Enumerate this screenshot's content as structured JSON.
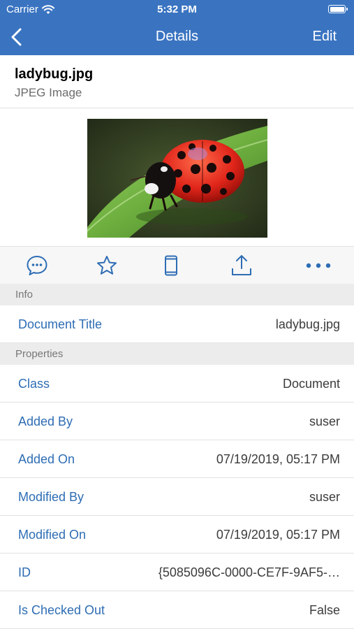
{
  "status_bar": {
    "carrier": "Carrier",
    "time": "5:32 PM",
    "wifi_icon": "wifi-icon",
    "battery_icon": "battery-icon"
  },
  "nav": {
    "back_icon": "chevron-left-icon",
    "title": "Details",
    "edit_label": "Edit"
  },
  "file": {
    "name": "ladybug.jpg",
    "type": "JPEG Image",
    "preview_subject": "ladybug on leaf"
  },
  "actions": [
    {
      "icon": "comment-icon"
    },
    {
      "icon": "star-icon"
    },
    {
      "icon": "phone-icon"
    },
    {
      "icon": "share-icon"
    },
    {
      "icon": "more-icon"
    }
  ],
  "sections": {
    "info": "Info",
    "properties": "Properties"
  },
  "info_rows": [
    {
      "label": "Document Title",
      "value": "ladybug.jpg"
    }
  ],
  "property_rows": [
    {
      "label": "Class",
      "value": "Document"
    },
    {
      "label": "Added By",
      "value": "suser"
    },
    {
      "label": "Added On",
      "value": "07/19/2019, 05:17 PM"
    },
    {
      "label": "Modified By",
      "value": "suser"
    },
    {
      "label": "Modified On",
      "value": "07/19/2019, 05:17 PM"
    },
    {
      "label": "ID",
      "value": "{5085096C-0000-CE7F-9AF5-…"
    },
    {
      "label": "Is Checked Out",
      "value": "False"
    }
  ],
  "colors": {
    "nav_background": "#3a74c1",
    "label_blue": "#2e6db4",
    "icon_blue": "#2e6db4"
  }
}
